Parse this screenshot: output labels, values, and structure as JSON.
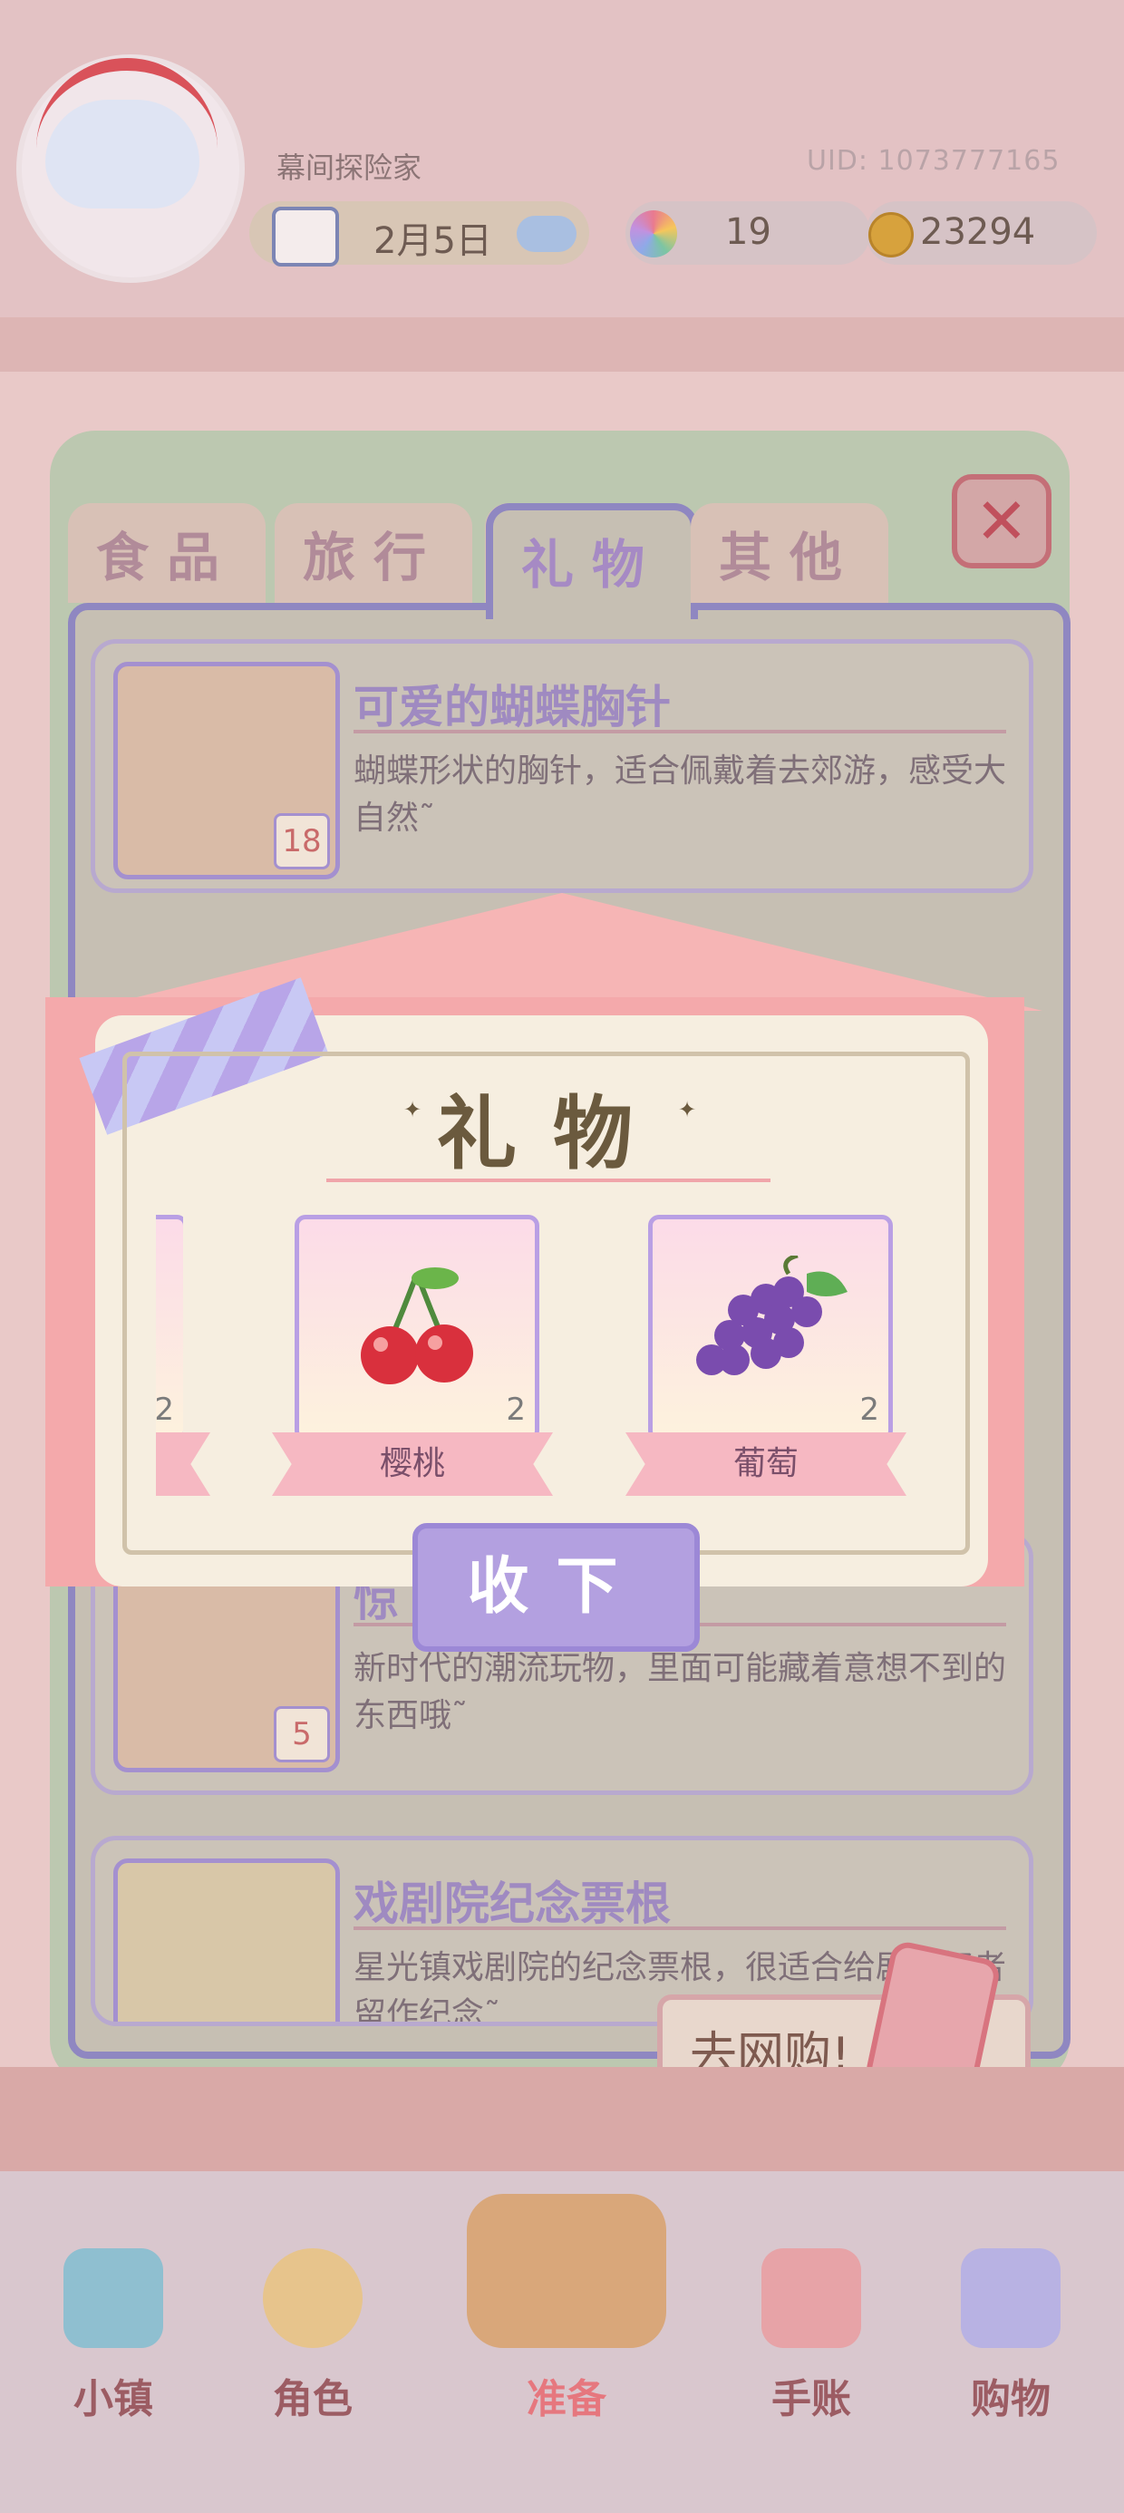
{
  "header": {
    "nickname": "幕间探险家",
    "uid": "UID: 1073777165",
    "date": "2月5日",
    "stars": "19",
    "coins": "23294"
  },
  "tabs": [
    {
      "label": "食品",
      "active": false
    },
    {
      "label": "旅行",
      "active": false
    },
    {
      "label": "礼物",
      "active": true
    },
    {
      "label": "其他",
      "active": false
    }
  ],
  "close_label": "✕",
  "items": [
    {
      "title": "可爱的蝴蝶胸针",
      "desc": "蝴蝶形状的胸针，适合佩戴着去郊游，感受大自然˜",
      "count": "18",
      "icon": "butterfly-brooch-icon"
    },
    {
      "title": "惊",
      "desc": "新时代的潮流玩物，里面可能藏着意想不到的东西哦˜",
      "count": "5",
      "icon": "gacha-ball-icon"
    },
    {
      "title": "戏剧院纪念票根",
      "desc": "星光镇戏剧院的纪念票根，很适合给剧爱好者留作纪念˜",
      "count": "",
      "icon": "ticket-icon"
    }
  ],
  "go_shop_label": "去网购!",
  "popup": {
    "title": "礼物",
    "gifts": [
      {
        "name": "",
        "qty": "2",
        "icon": "gift-icon"
      },
      {
        "name": "樱桃",
        "qty": "2",
        "icon": "cherry-icon"
      },
      {
        "name": "葡萄",
        "qty": "2",
        "icon": "grape-icon"
      }
    ],
    "accept_label": "收下"
  },
  "nav": [
    {
      "label": "小镇",
      "icon": "map-icon"
    },
    {
      "label": "角色",
      "icon": "character-icon"
    },
    {
      "label": "准备",
      "icon": "basket-icon"
    },
    {
      "label": "手账",
      "icon": "journal-icon"
    },
    {
      "label": "购物",
      "icon": "shopping-bag-icon"
    }
  ],
  "colors": {
    "accent_purple": "#a68ac4",
    "accent_pink": "#f4a9ab",
    "panel_green": "#bcc8b0"
  }
}
